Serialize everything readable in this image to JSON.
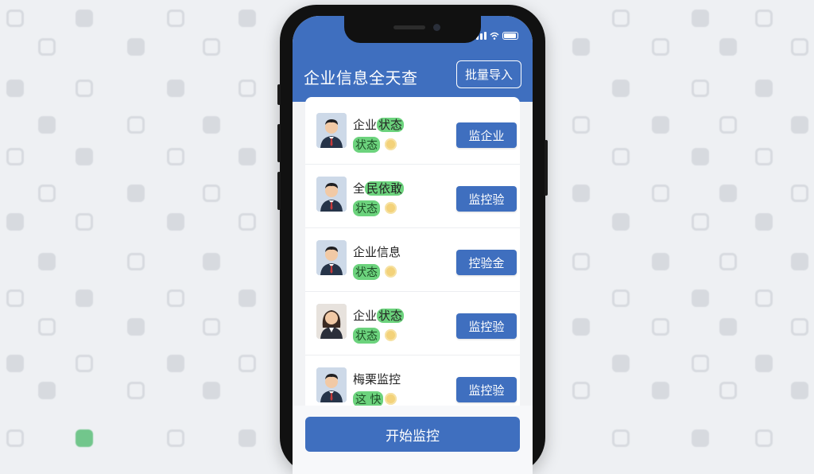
{
  "app": {
    "title": "企业信息全天查",
    "batch_import_label": "批量导入"
  },
  "companies": [
    {
      "name_prefix": "企业",
      "name_highlight": "状态",
      "status": "状态",
      "action": "监企业",
      "avatar": "male"
    },
    {
      "name_prefix": "全",
      "name_highlight": "民依敢",
      "status": "状态",
      "action": "监控验",
      "avatar": "male"
    },
    {
      "name_prefix": "企业信息",
      "name_highlight": "",
      "status": "状态",
      "action": "控验金",
      "avatar": "male"
    },
    {
      "name_prefix": "企业",
      "name_highlight": "状态",
      "status": "状态",
      "action": "监控验",
      "avatar": "female"
    },
    {
      "name_prefix": "梅栗监控",
      "name_highlight": "",
      "status": "这 快",
      "action": "监控验",
      "avatar": "male"
    }
  ],
  "footer": {
    "start_label": "开始监控"
  },
  "colors": {
    "primary": "#3f6fbf",
    "status_green": "#6cd37d",
    "coin": "#f3d27a"
  },
  "icons": {
    "status_bar": [
      "signal-icon",
      "wifi-icon",
      "battery-icon"
    ],
    "row_badge": "coin-icon"
  }
}
